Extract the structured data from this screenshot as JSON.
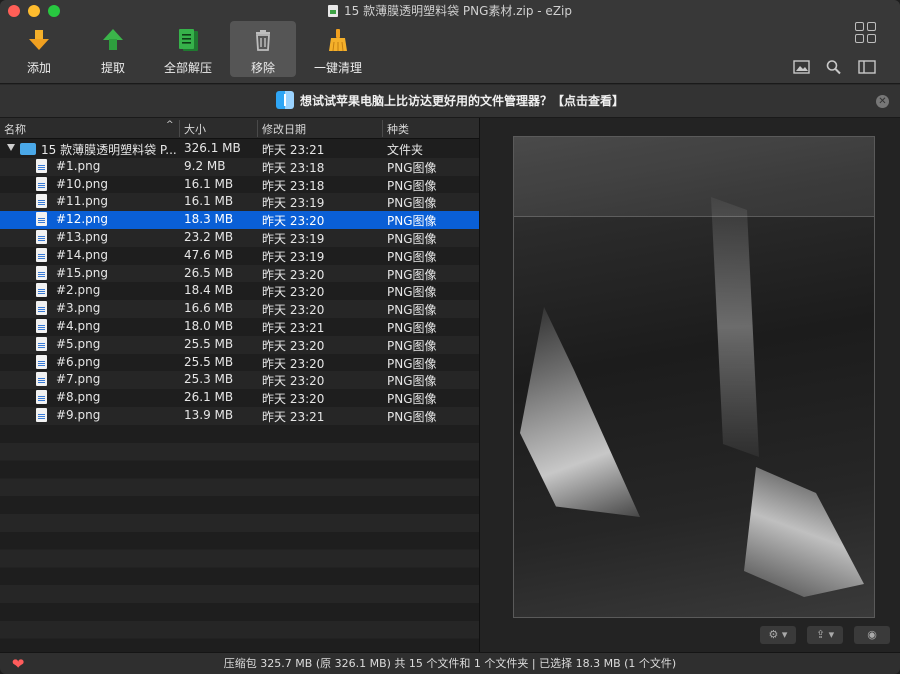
{
  "window": {
    "title": "15 款薄膜透明塑料袋 PNG素材.zip - eZip"
  },
  "toolbar": {
    "add": "添加",
    "extract": "提取",
    "extract_all": "全部解压",
    "remove": "移除",
    "clean": "一键清理"
  },
  "banner": {
    "text": "想试试苹果电脑上比访达更好用的文件管理器？【点击查看】"
  },
  "columns": {
    "name": "名称",
    "size": "大小",
    "modified": "修改日期",
    "kind": "种类"
  },
  "folder": {
    "name": "15 款薄膜透明塑料袋 P...",
    "size": "326.1 MB",
    "modified": "昨天 23:21",
    "kind": "文件夹"
  },
  "files": [
    {
      "name": "#1.png",
      "size": "9.2 MB",
      "modified": "昨天 23:18",
      "kind": "PNG图像"
    },
    {
      "name": "#10.png",
      "size": "16.1 MB",
      "modified": "昨天 23:18",
      "kind": "PNG图像"
    },
    {
      "name": "#11.png",
      "size": "16.1 MB",
      "modified": "昨天 23:19",
      "kind": "PNG图像"
    },
    {
      "name": "#12.png",
      "size": "18.3 MB",
      "modified": "昨天 23:20",
      "kind": "PNG图像",
      "selected": true
    },
    {
      "name": "#13.png",
      "size": "23.2 MB",
      "modified": "昨天 23:19",
      "kind": "PNG图像"
    },
    {
      "name": "#14.png",
      "size": "47.6 MB",
      "modified": "昨天 23:19",
      "kind": "PNG图像"
    },
    {
      "name": "#15.png",
      "size": "26.5 MB",
      "modified": "昨天 23:20",
      "kind": "PNG图像"
    },
    {
      "name": "#2.png",
      "size": "18.4 MB",
      "modified": "昨天 23:20",
      "kind": "PNG图像"
    },
    {
      "name": "#3.png",
      "size": "16.6 MB",
      "modified": "昨天 23:20",
      "kind": "PNG图像"
    },
    {
      "name": "#4.png",
      "size": "18.0 MB",
      "modified": "昨天 23:21",
      "kind": "PNG图像"
    },
    {
      "name": "#5.png",
      "size": "25.5 MB",
      "modified": "昨天 23:20",
      "kind": "PNG图像"
    },
    {
      "name": "#6.png",
      "size": "25.5 MB",
      "modified": "昨天 23:20",
      "kind": "PNG图像"
    },
    {
      "name": "#7.png",
      "size": "25.3 MB",
      "modified": "昨天 23:20",
      "kind": "PNG图像"
    },
    {
      "name": "#8.png",
      "size": "26.1 MB",
      "modified": "昨天 23:20",
      "kind": "PNG图像"
    },
    {
      "name": "#9.png",
      "size": "13.9 MB",
      "modified": "昨天 23:21",
      "kind": "PNG图像"
    }
  ],
  "statusbar": {
    "text": "压缩包 325.7 MB (原 326.1 MB) 共 15 个文件和 1 个文件夹  |  已选择 18.3 MB (1 个文件)"
  },
  "colors": {
    "selection": "#0a5fd6",
    "accent_green": "#3da244",
    "accent_orange": "#f0a020"
  }
}
